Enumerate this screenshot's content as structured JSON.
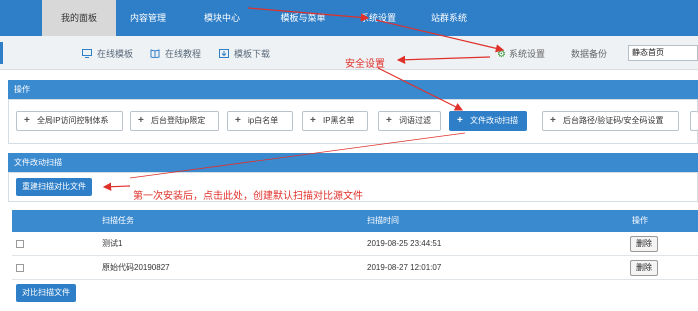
{
  "topnav": {
    "tabs": [
      {
        "label": "我的面板",
        "active": true
      },
      {
        "label": "内容管理",
        "active": false
      },
      {
        "label": "模块中心",
        "active": false
      },
      {
        "label": "模板与菜单",
        "active": false
      },
      {
        "label": "系统设置",
        "active": false
      },
      {
        "label": "站群系统",
        "active": false
      }
    ]
  },
  "subbar": {
    "links": [
      {
        "label": "在线模板",
        "icon": "monitor-icon"
      },
      {
        "label": "在线教程",
        "icon": "book-icon"
      },
      {
        "label": "模板下载",
        "icon": "download-icon"
      }
    ],
    "settings_label": "系统设置",
    "backup_label": "数据备份",
    "home_value": "静态首页"
  },
  "actions": {
    "title": "操作",
    "buttons": [
      {
        "label": "全局IP访问控制体系",
        "active": false
      },
      {
        "label": "后台登陆ip限定",
        "active": false
      },
      {
        "label": "ip白名单",
        "active": false
      },
      {
        "label": "IP黑名单",
        "active": false
      },
      {
        "label": "词语过滤",
        "active": false
      },
      {
        "label": "文件改动扫描",
        "active": true
      },
      {
        "label": "后台路径/验证码/安全码设置",
        "active": false
      }
    ]
  },
  "scan": {
    "title": "文件改动扫描",
    "rebuild_label": "重建扫描对比文件",
    "compare_label": "对比扫描文件",
    "columns": {
      "task": "扫描任务",
      "time": "扫描时间",
      "action": "操作"
    },
    "rows": [
      {
        "task": "测试1",
        "time": "2019-08-25 23:44:51",
        "action": "删除"
      },
      {
        "task": "原始代码20190827",
        "time": "2019-08-27 12:01:07",
        "action": "删除"
      }
    ]
  },
  "annotations": {
    "security": "安全设置",
    "first_install": "第一次安装后，点击此处，创建默认扫描对比源文件"
  },
  "colors": {
    "primary": "#2f7fc8",
    "annotation": "#e0302a"
  }
}
